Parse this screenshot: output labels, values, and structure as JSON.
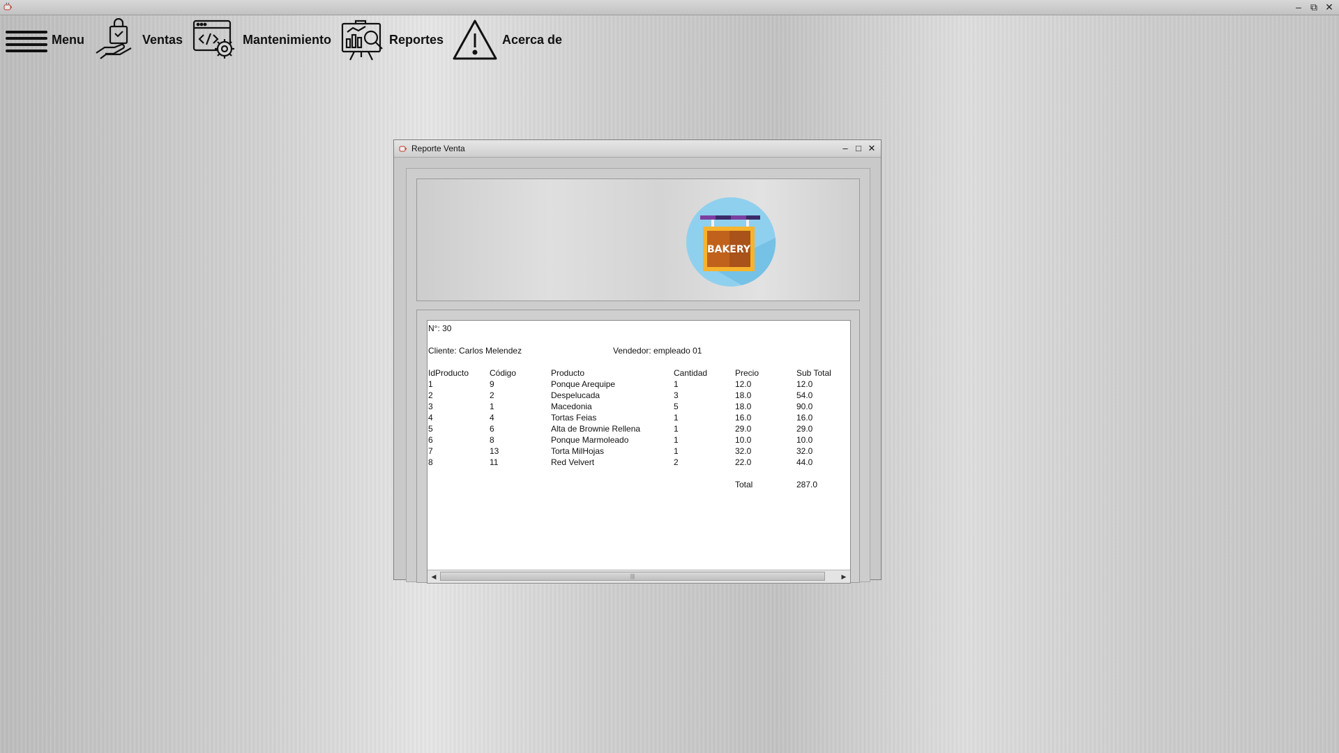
{
  "menubar": {
    "items": [
      {
        "label": "Menu",
        "icon": "hamburger-icon"
      },
      {
        "label": "Ventas",
        "icon": "shopping-hand-icon"
      },
      {
        "label": "Mantenimiento",
        "icon": "code-settings-icon"
      },
      {
        "label": "Reportes",
        "icon": "report-analytics-icon"
      },
      {
        "label": "Acerca de",
        "icon": "warning-icon"
      }
    ]
  },
  "window": {
    "title": "Reporte Venta",
    "logo_text": "BAKERY"
  },
  "report": {
    "numero": "N°: 30",
    "cliente": "Cliente: Carlos Melendez",
    "vendedor": "Vendedor: empleado 01",
    "columns": [
      "IdProducto",
      "Código",
      "Producto",
      "Cantidad",
      "Precio",
      "Sub Total"
    ],
    "rows": [
      [
        "1",
        "9",
        "Ponque Arequipe",
        "1",
        "12.0",
        "12.0"
      ],
      [
        "2",
        "2",
        "Despelucada",
        "3",
        "18.0",
        "54.0"
      ],
      [
        "3",
        "1",
        "Macedonia",
        "5",
        "18.0",
        "90.0"
      ],
      [
        "4",
        "4",
        "Tortas Feias",
        "1",
        "16.0",
        "16.0"
      ],
      [
        "5",
        "6",
        "Alta de Brownie Rellena",
        "1",
        "29.0",
        "29.0"
      ],
      [
        "6",
        "8",
        "Ponque Marmoleado",
        "1",
        "10.0",
        "10.0"
      ],
      [
        "7",
        "13",
        "Torta MilHojas",
        "1",
        "32.0",
        "32.0"
      ],
      [
        "8",
        "11",
        "Red Velvert",
        "2",
        "22.0",
        "44.0"
      ]
    ],
    "total_label": "Total",
    "total_value": "287.0"
  }
}
